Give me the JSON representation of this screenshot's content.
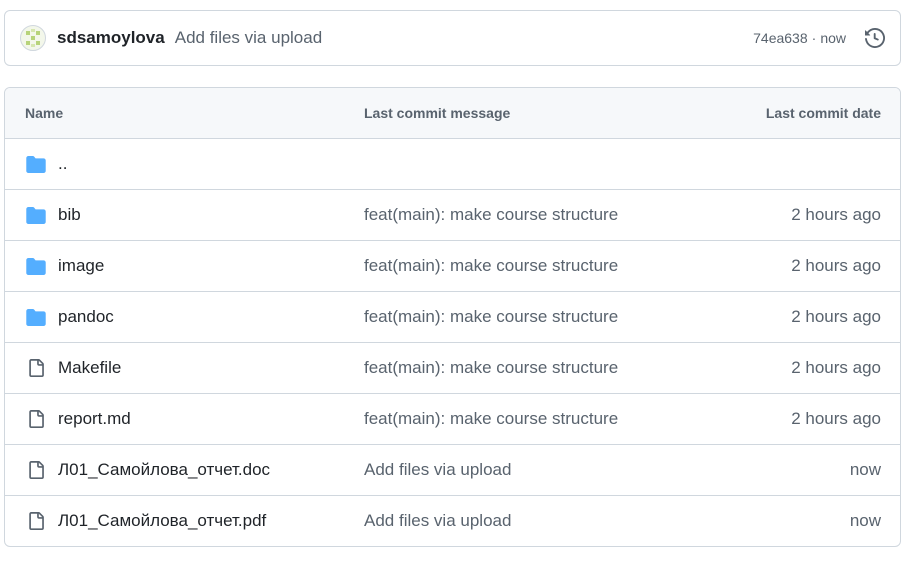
{
  "commit": {
    "author": "sdsamoylova",
    "message": "Add files via upload",
    "sha": "74ea638",
    "separator": "·",
    "time": "now"
  },
  "table": {
    "headers": {
      "name": "Name",
      "message": "Last commit message",
      "date": "Last commit date"
    },
    "rows": [
      {
        "name": "..",
        "message": "",
        "date": "",
        "icon": "folder-icon"
      },
      {
        "name": "bib",
        "message": "feat(main): make course structure",
        "date": "2 hours ago",
        "icon": "folder-icon"
      },
      {
        "name": "image",
        "message": "feat(main): make course structure",
        "date": "2 hours ago",
        "icon": "folder-icon"
      },
      {
        "name": "pandoc",
        "message": "feat(main): make course structure",
        "date": "2 hours ago",
        "icon": "folder-icon"
      },
      {
        "name": "Makefile",
        "message": "feat(main): make course structure",
        "date": "2 hours ago",
        "icon": "file-icon"
      },
      {
        "name": "report.md",
        "message": "feat(main): make course structure",
        "date": "2 hours ago",
        "icon": "file-icon"
      },
      {
        "name": "Л01_Самойлова_отчет.doc",
        "message": "Add files via upload",
        "date": "now",
        "icon": "file-icon"
      },
      {
        "name": "Л01_Самойлова_отчет.pdf",
        "message": "Add files via upload",
        "date": "now",
        "icon": "file-icon"
      }
    ]
  },
  "colors": {
    "folder": "#54aeff",
    "border": "#d0d7de",
    "muted_text": "#59636e",
    "header_bg": "#f6f8fa"
  }
}
